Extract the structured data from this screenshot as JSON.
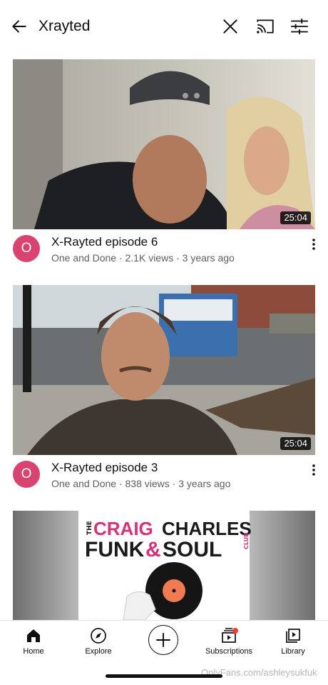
{
  "search": {
    "query": "Xrayted"
  },
  "icons": {
    "back": "arrow-left-icon",
    "clear": "close-icon",
    "cast": "cast-icon",
    "filter": "filter-sliders-icon",
    "more": "more-vertical-icon"
  },
  "videos": [
    {
      "title": "X-Rayted episode 6",
      "channel_initial": "O",
      "subtitle": "One and Done · 2.1K views · 3 years ago",
      "duration": "25:04"
    },
    {
      "title": "X-Rayted episode 3",
      "channel_initial": "O",
      "subtitle": "One and Done · 838 views · 3 years ago",
      "duration": "25:04"
    },
    {
      "title": "",
      "channel_initial": "",
      "subtitle": "",
      "duration": "",
      "thumb_text_line1_a": "THE",
      "thumb_text_line1_b": "CRAIG",
      "thumb_text_line1_c": "CHARLES",
      "thumb_text_line2_a": "FUNK",
      "thumb_text_line2_b": "&",
      "thumb_text_line2_c": "SOUL",
      "thumb_text_club": "CLUB"
    }
  ],
  "nav": {
    "home": "Home",
    "explore": "Explore",
    "subscriptions": "Subscriptions",
    "library": "Library"
  },
  "watermark": "OnlyFans.com/ashleysukfuk",
  "colors": {
    "avatar": "#d9436f",
    "notification_dot": "#ff3d2e",
    "brand_pink": "#d5327a"
  }
}
